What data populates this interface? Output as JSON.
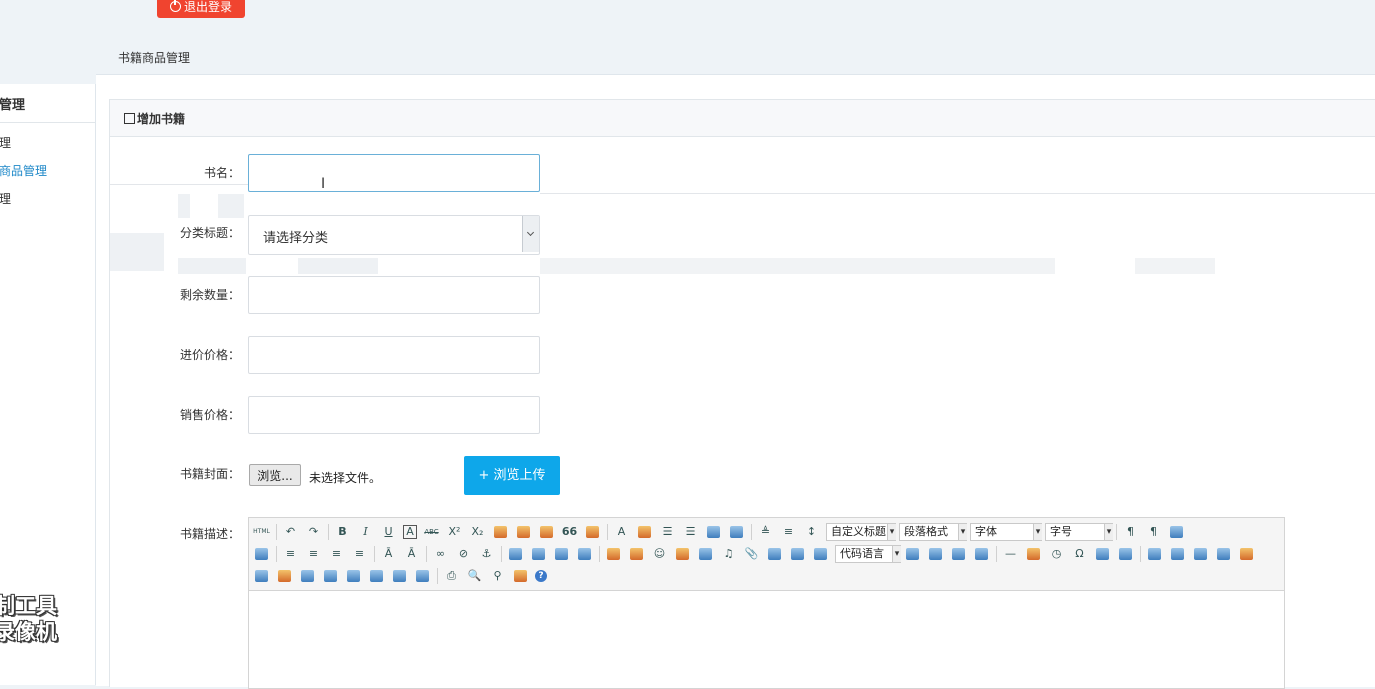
{
  "topbar": {
    "logout_label": "退出登录"
  },
  "breadcrumb": "书籍商品管理",
  "sidebar": {
    "title": "管理",
    "items": [
      {
        "label": "理",
        "active": false
      },
      {
        "label": "商品管理",
        "active": true
      },
      {
        "label": "理",
        "active": false
      }
    ],
    "watermark_line1": "制工具",
    "watermark_line2": "录像机"
  },
  "panel": {
    "title": "增加书籍"
  },
  "form": {
    "book_name_label": "书名：",
    "book_name_value": "",
    "category_label": "分类标题：",
    "category_selected": "请选择分类",
    "stock_label": "剩余数量：",
    "stock_value": "",
    "cost_label": "进价价格：",
    "cost_value": "",
    "sale_label": "销售价格：",
    "sale_value": "",
    "cover_label": "书籍封面：",
    "browse_label": "浏览...",
    "no_file_text": "未选择文件。",
    "upload_label": "+ 浏览上传",
    "desc_label": "书籍描述："
  },
  "editor": {
    "toolbar_row1": [
      "html",
      "undo",
      "redo",
      "bold",
      "italic",
      "underline",
      "fontborder",
      "strikethrough",
      "superscript",
      "subscript",
      "removeformat",
      "formatmatch",
      "autotypeset",
      "blockquote",
      "pasteplain",
      "forecolor",
      "backcolor",
      "insertorderedlist",
      "insertunorderedlist",
      "selectall",
      "cleardoc",
      "rowspacingtop",
      "rowspacingbottom",
      "lineheight"
    ],
    "custom_title": "自定义标题",
    "paragraph": "段落格式",
    "font_family": "字体",
    "font_size": "字号",
    "code_language": "代码语言",
    "glyphs": {
      "bold": "B",
      "italic": "I",
      "underline": "U",
      "fontborder": "A",
      "strike": "ABC",
      "sup": "X²",
      "sub": "X₂",
      "quote": "66",
      "fontcolor": "A",
      "omega": "Ω",
      "help": "?"
    }
  },
  "colors": {
    "accent": "#0ea7ea",
    "danger": "#f0442f",
    "sidebar_active": "#1e88c8"
  }
}
